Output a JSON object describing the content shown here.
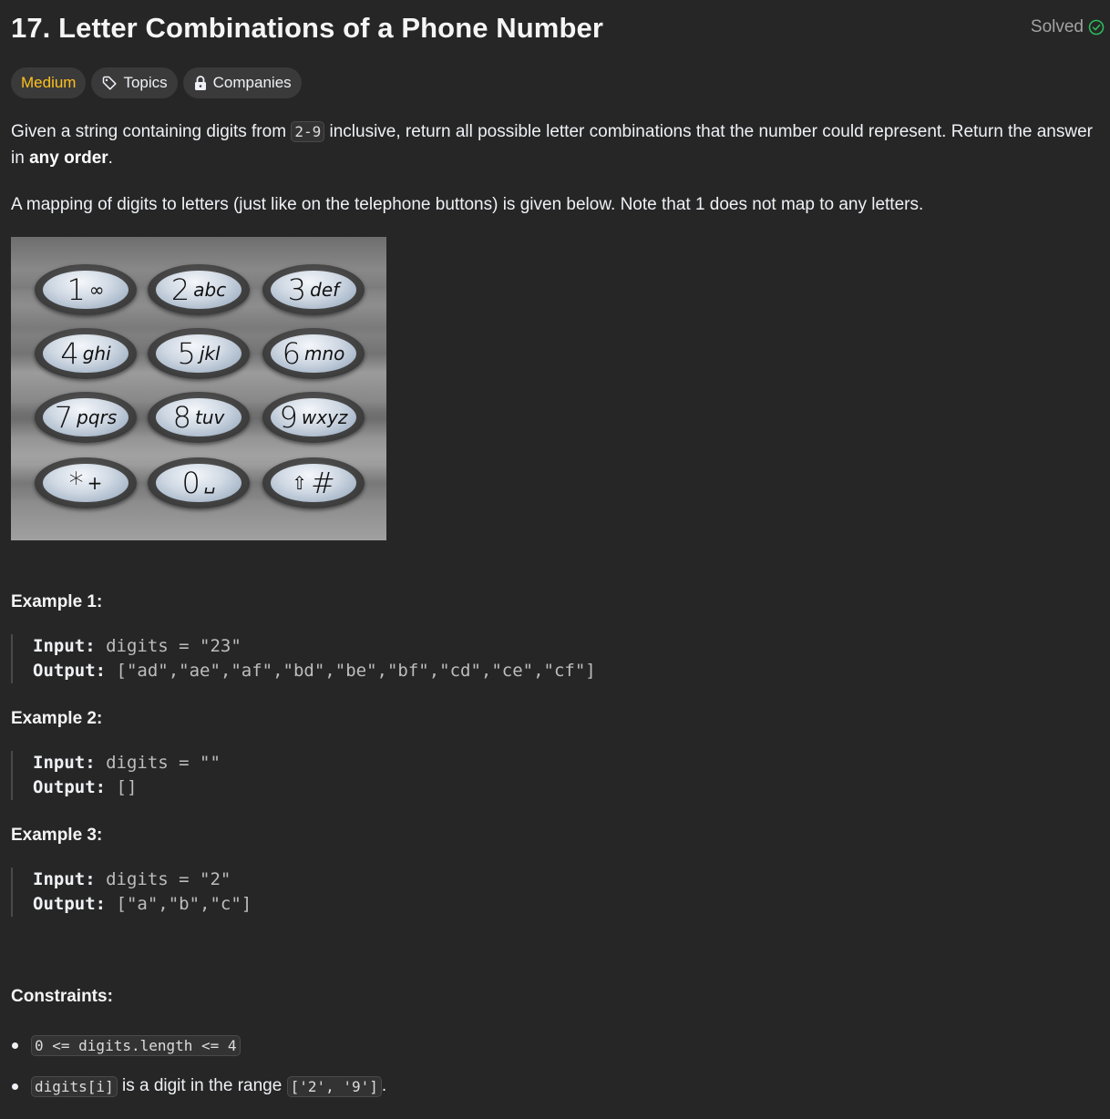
{
  "problem": {
    "title": "17. Letter Combinations of a Phone Number",
    "status": "Solved",
    "status_color": "#2cbb5d"
  },
  "tags": {
    "difficulty": "Medium",
    "difficulty_color": "#ffc01e",
    "topics": "Topics",
    "companies": "Companies"
  },
  "description": {
    "p1_a": "Given a string containing digits from ",
    "p1_code": "2-9",
    "p1_b": " inclusive, return all possible letter combinations that the number could represent. Return the answer in ",
    "p1_bold": "any order",
    "p1_c": ".",
    "p2": "A mapping of digits to letters (just like on the telephone buttons) is given below. Note that 1 does not map to any letters."
  },
  "keypad": [
    {
      "digit": "1",
      "letters": "∞"
    },
    {
      "digit": "2",
      "letters": "abc"
    },
    {
      "digit": "3",
      "letters": "def"
    },
    {
      "digit": "4",
      "letters": "ghi"
    },
    {
      "digit": "5",
      "letters": "jkl"
    },
    {
      "digit": "6",
      "letters": "mno"
    },
    {
      "digit": "7",
      "letters": "pqrs"
    },
    {
      "digit": "8",
      "letters": "tuv"
    },
    {
      "digit": "9",
      "letters": "wxyz"
    },
    {
      "digit": "*",
      "letters": "+"
    },
    {
      "digit": "0",
      "letters": "␣"
    },
    {
      "digit": "#",
      "letters": "⇧"
    }
  ],
  "examples": [
    {
      "heading": "Example 1:",
      "input_label": "Input:",
      "input": "digits = \"23\"",
      "output_label": "Output:",
      "output": "[\"ad\",\"ae\",\"af\",\"bd\",\"be\",\"bf\",\"cd\",\"ce\",\"cf\"]"
    },
    {
      "heading": "Example 2:",
      "input_label": "Input:",
      "input": "digits = \"\"",
      "output_label": "Output:",
      "output": "[]"
    },
    {
      "heading": "Example 3:",
      "input_label": "Input:",
      "input": "digits = \"2\"",
      "output_label": "Output:",
      "output": "[\"a\",\"b\",\"c\"]"
    }
  ],
  "constraints": {
    "heading": "Constraints:",
    "c1_code": "0 <= digits.length <= 4",
    "c2_code1": "digits[i]",
    "c2_text": " is a digit in the range ",
    "c2_code2": "['2', '9']",
    "c2_end": "."
  }
}
